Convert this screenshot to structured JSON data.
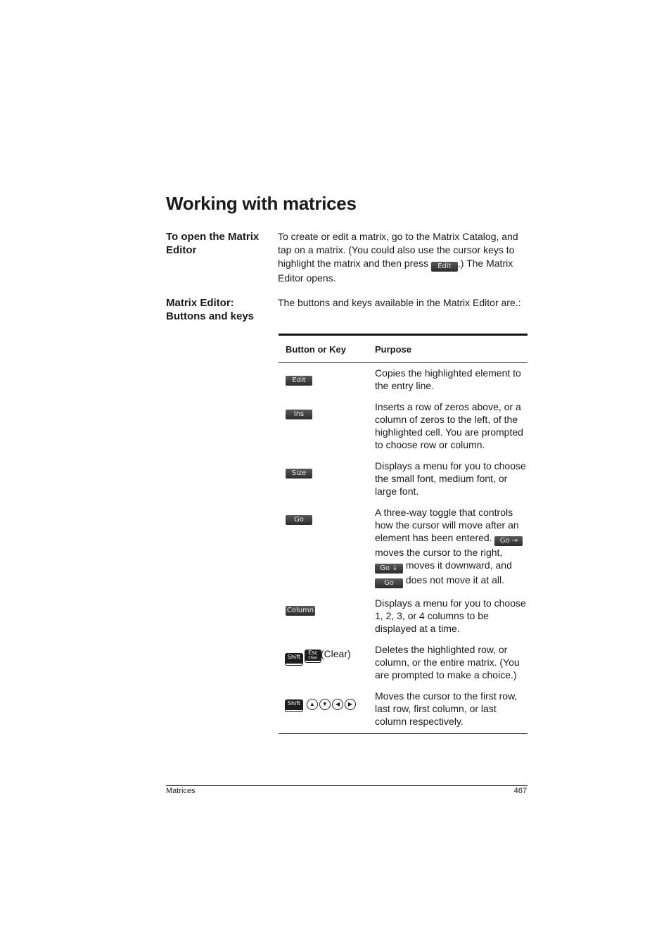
{
  "page_title": "Working with matrices",
  "sections": [
    {
      "heading": "To open the Matrix Editor",
      "text_before": "To create or edit a matrix, go to the Matrix Catalog, and tap on a matrix. (You could also use the cursor keys to highlight the matrix and then press ",
      "inline_key": "Edit",
      "text_after": ".) The Matrix Editor opens."
    },
    {
      "heading_line1": "Matrix Editor:",
      "heading_line2": "Buttons and keys",
      "text": "The buttons and keys available in the Matrix Editor are.:"
    }
  ],
  "table": {
    "headers": [
      "Button or Key",
      "Purpose"
    ],
    "rows": [
      {
        "key": "Edit",
        "purpose": "Copies the highlighted element to the entry line."
      },
      {
        "key": "Ins",
        "purpose": "Inserts a row of zeros above, or a column of zeros to the left, of the highlighted cell. You are prompted to choose row or column."
      },
      {
        "key": "Size",
        "purpose": "Displays a menu for you to choose the small font, medium font, or large font."
      },
      {
        "key": "Go",
        "purpose_a": "A three-way toggle that controls how the cursor will move after an element has been entered.",
        "key_right": "Go →",
        "purpose_b": "moves the cursor to the right,",
        "key_down": "Go ↓",
        "purpose_c": "moves it downward, and",
        "key_none": "Go",
        "purpose_d": "does not move it at all."
      },
      {
        "key": "Column",
        "purpose": "Displays a menu for you to choose 1, 2, 3, or 4 columns to be displayed at a time."
      },
      {
        "key_shift": "Shift",
        "key_esc": "Esc",
        "key_esc_sub": "Clear",
        "key_suffix": "(Clear)",
        "purpose": "Deletes the highlighted row, or column, or the entire matrix. (You are prompted to make a choice.)"
      },
      {
        "key_shift": "Shift",
        "arrows": [
          "up-arrow",
          "down-arrow",
          "left-arrow",
          "right-arrow"
        ],
        "purpose": "Moves the cursor to the first row, last row, first column, or last column respectively."
      }
    ]
  },
  "footer": {
    "section": "Matrices",
    "page_number": "467"
  }
}
